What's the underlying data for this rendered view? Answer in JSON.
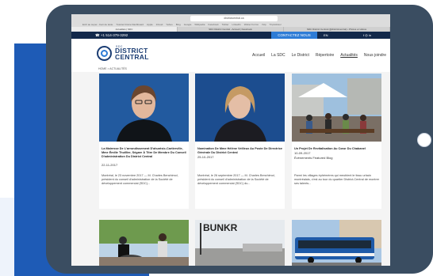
{
  "browser": {
    "url": "districtcentral.ca",
    "bookmarks": [
      "Ecrit au super...Ceci de taste",
      "Tutoriel-Vinnie Dashboard",
      "Apple",
      "iCloud",
      "Yahoo",
      "Bing",
      "Google",
      "Wikipedia",
      "Facebook",
      "Twitter",
      "LinkedIn",
      "Weber Forms",
      "Yelp",
      "TripAdvisor"
    ],
    "tabs": [
      "Actualités | SDC",
      "SDC District Central - Accueil | Facebook",
      "SDC District Central (@districtcentral) • Photos et vidéos"
    ]
  },
  "topbar": {
    "phone": "☎ +1 514-379-3292",
    "contact": "CONTACTEZ NOUS",
    "lang": "EN",
    "social": "f ◎ in"
  },
  "logo": {
    "small": "SDC",
    "line1": "DISTRICT",
    "line2": "CENTRAL"
  },
  "nav": [
    "Accueil",
    "La SDC",
    "Le District",
    "Répertoire",
    "Actualités",
    "Nous joindre"
  ],
  "breadcrumb": "HOME > ACTUALITÉS",
  "cards": [
    {
      "title": "La Mairesse De L'arrondissement D'ahuntsic-Cartierville, Mme Émilie Thuillier, Ségare À Titre De Membre Du Conseil D'administration Du District Central",
      "date": "22-11-2017",
      "excerpt": "Montréal, le 23 novembre 2017 — M. Charles Benchimol, président du conseil d'administration de la Société de développement commercial (SDC)..."
    },
    {
      "title": "Nomination De Mme Hélène Veilleux Au Poste De Directrice Générale Du District Central",
      "date": "25-10-2017",
      "excerpt": "Montréal, le 26 septembre 2017 — M. Charles Benchimol, président du conseil d'administration de la Société de développement commercial (SDC) du..."
    },
    {
      "title": "Un Projet De Revitalisation Au Cœur Du Chabanel",
      "date": "10-09-2017",
      "tag": "Événements Featured Blog",
      "excerpt": "Parmi les villages éphémères qui meublent le tissu urbain montréalais, c'est au tour du quartier District-Central de montrer ses talents..."
    }
  ],
  "bunkr_sign": "BUNKR",
  "colors": {
    "tablet": "#3a4d61",
    "brand_navy": "#12284a",
    "accent_blue": "#2e7cd6",
    "page_bg": "#1e5bb6"
  }
}
